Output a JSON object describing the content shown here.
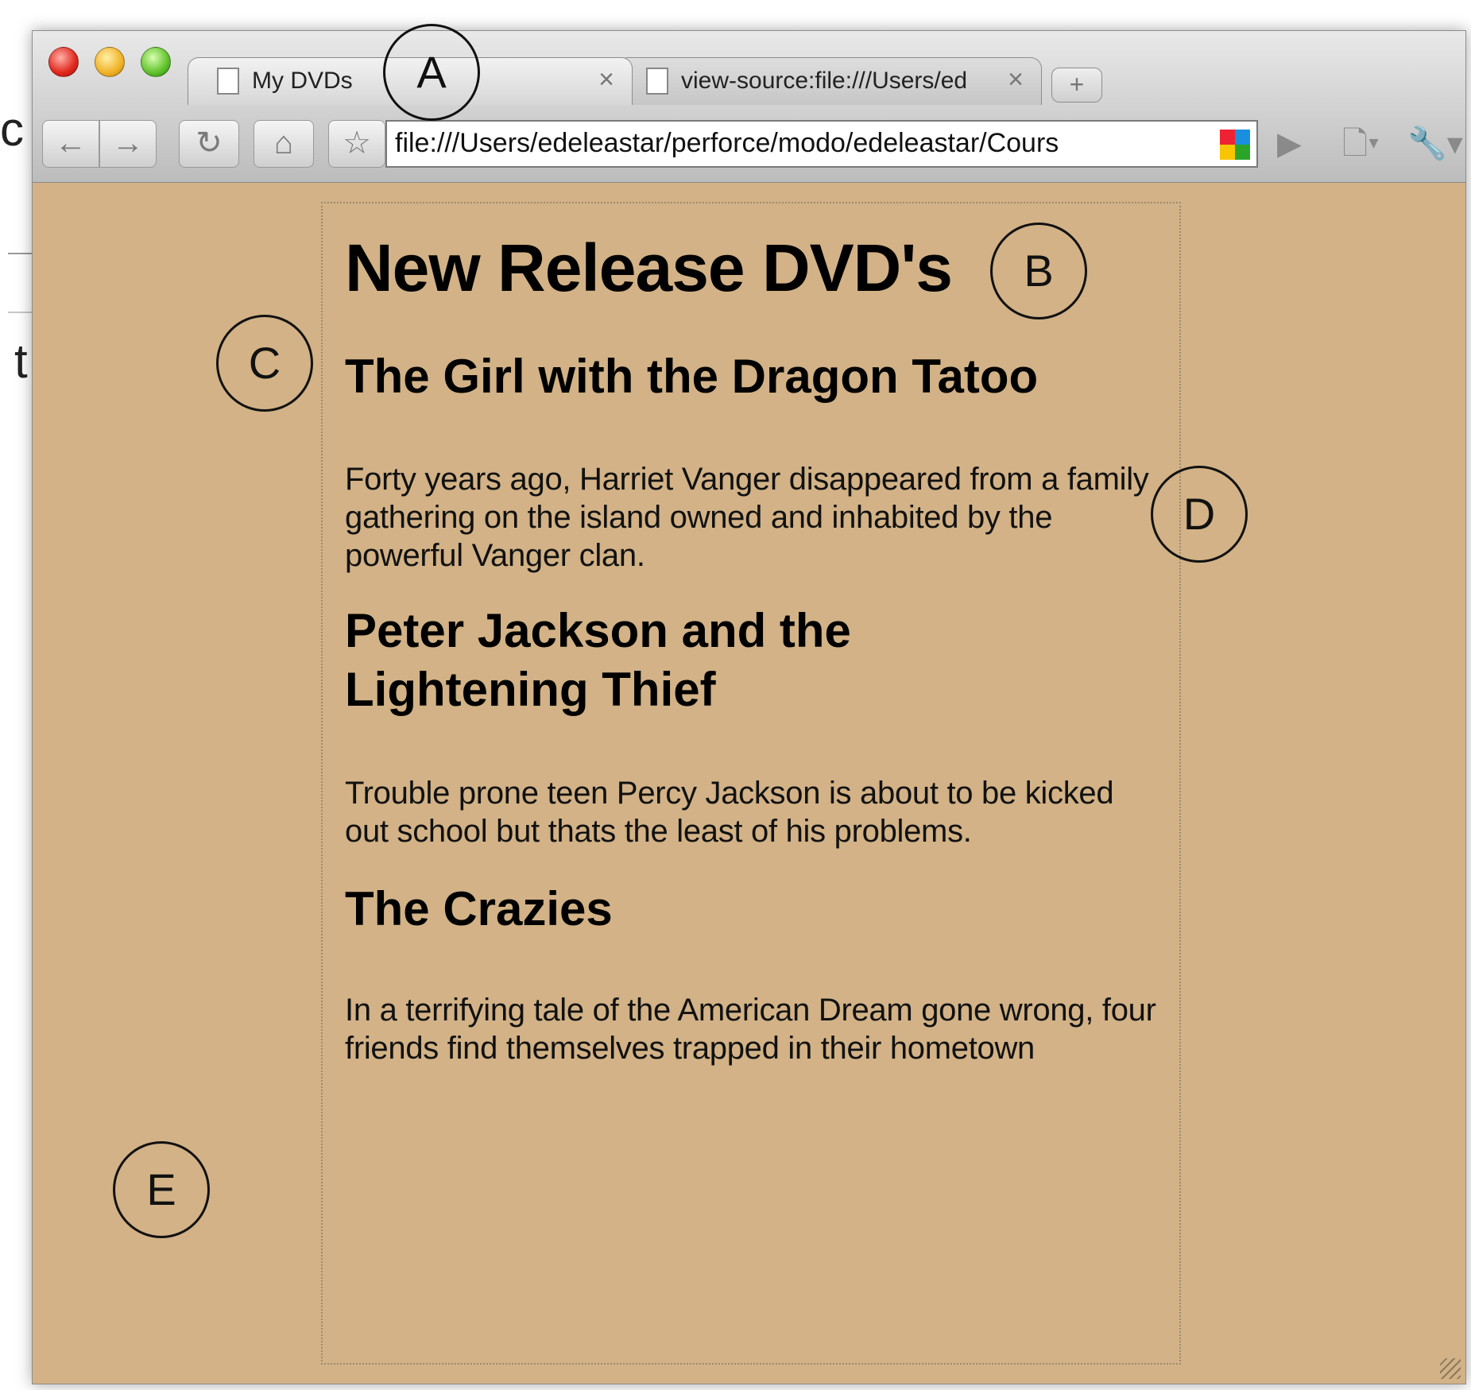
{
  "browser": {
    "tabs": [
      {
        "title": "My DVDs",
        "close": "×"
      },
      {
        "title": "view-source:file:///Users/ed",
        "close": "×"
      }
    ],
    "new_tab": "+",
    "toolbar": {
      "back": "←",
      "forward": "→",
      "reload": "↻",
      "home": "⌂",
      "star": "☆",
      "go": "▶",
      "page_menu": "🗋▾",
      "wrench_menu": "🔧▾"
    },
    "address": "file:///Users/edeleastar/perforce/modo/edeleastar/Cours"
  },
  "page": {
    "title": "New Release DVD's",
    "movies": [
      {
        "title": "The Girl with the Dragon Tatoo",
        "description": "Forty years ago, Harriet Vanger disappeared from a family gathering on the island owned and inhabited by the powerful Vanger clan."
      },
      {
        "title": "Peter Jackson and the Lightening Thief",
        "description": "Trouble prone teen Percy Jackson is about to be kicked out school but thats the least of his problems."
      },
      {
        "title": "The Crazies",
        "description": "In a terrifying tale of the American Dream gone wrong, four friends find themselves trapped in their hometown"
      }
    ]
  },
  "callouts": [
    "A",
    "B",
    "C",
    "D",
    "E"
  ],
  "background_text": {
    "left_letter": "t",
    "top_letter": "c"
  },
  "colors": {
    "page_background": "#d2b286"
  }
}
